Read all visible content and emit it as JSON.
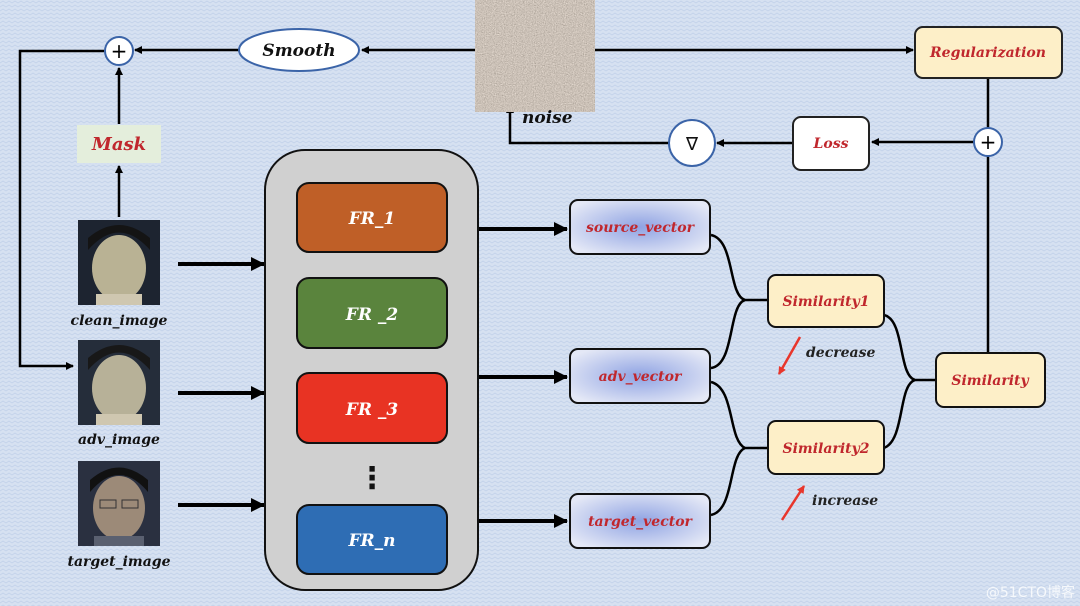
{
  "nodes": {
    "smooth": "Smooth",
    "noise": "noise",
    "regularization": "Regularization",
    "loss": "Loss",
    "gradient": "∇",
    "plus": "+",
    "mask": "Mask",
    "clean_image": "clean_image",
    "adv_image": "adv_image",
    "target_image": "target_image",
    "fr1": "FR_1",
    "fr2": "FR _2",
    "fr3": "FR _3",
    "frn": "FR_n",
    "ellipsis": "⋮",
    "source_vector": "source_vector",
    "adv_vector": "adv_vector",
    "target_vector": "target_vector",
    "similarity1": "Similarity1",
    "similarity2": "Similarity2",
    "similarity": "Similarity",
    "decrease": "decrease",
    "increase": "increase"
  },
  "watermark": "@51CTO博客",
  "colors": {
    "fr1": "#bf5f27",
    "fr2": "#5a843d",
    "fr3": "#e83323",
    "frn": "#2e6db4",
    "label_red": "#c0272d",
    "sim_fill": "#fdefc8",
    "mask_fill": "#e4eedc"
  }
}
